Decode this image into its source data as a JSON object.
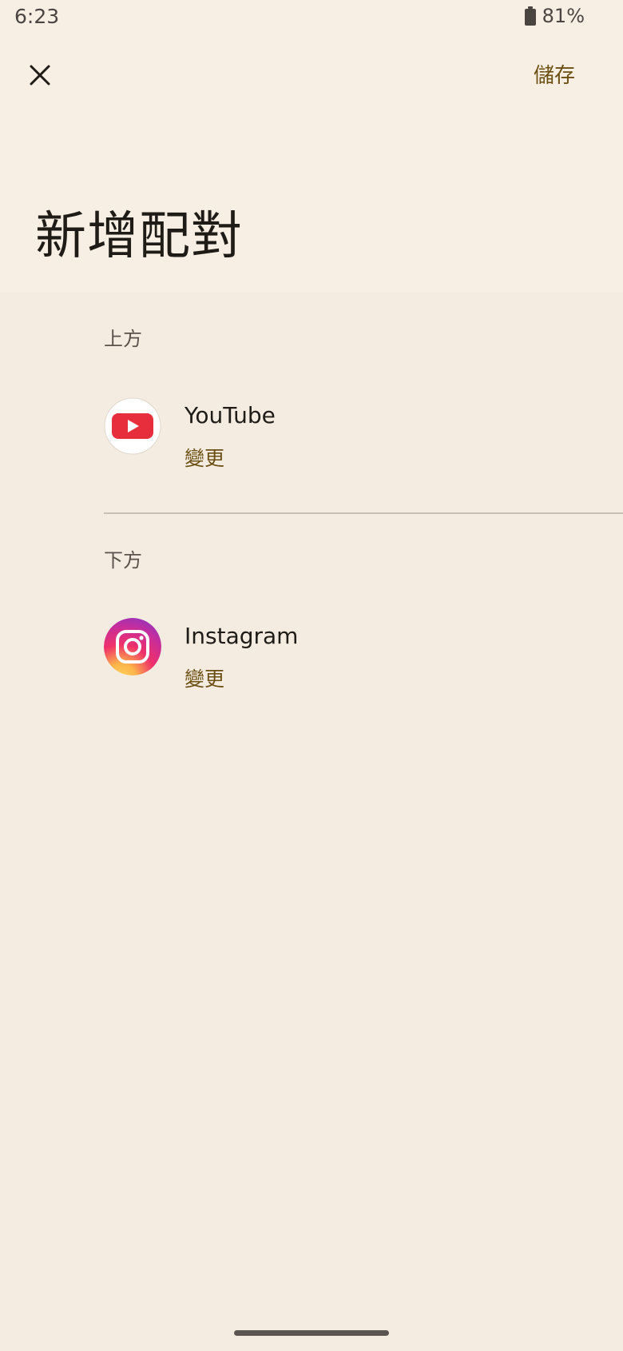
{
  "status_bar": {
    "time": "6:23",
    "battery": "81%"
  },
  "header": {
    "close_icon": "close-icon",
    "save_label": "儲存",
    "title": "新增配對"
  },
  "sections": [
    {
      "label": "上方",
      "app": {
        "name": "YouTube",
        "icon": "youtube-icon",
        "change_label": "變更"
      }
    },
    {
      "label": "下方",
      "app": {
        "name": "Instagram",
        "icon": "instagram-icon",
        "change_label": "變更"
      }
    }
  ],
  "colors": {
    "accent": "#6b4f12",
    "background": "#f4ece0",
    "header_background": "#f7efe3",
    "youtube_red": "#e62e3d"
  }
}
